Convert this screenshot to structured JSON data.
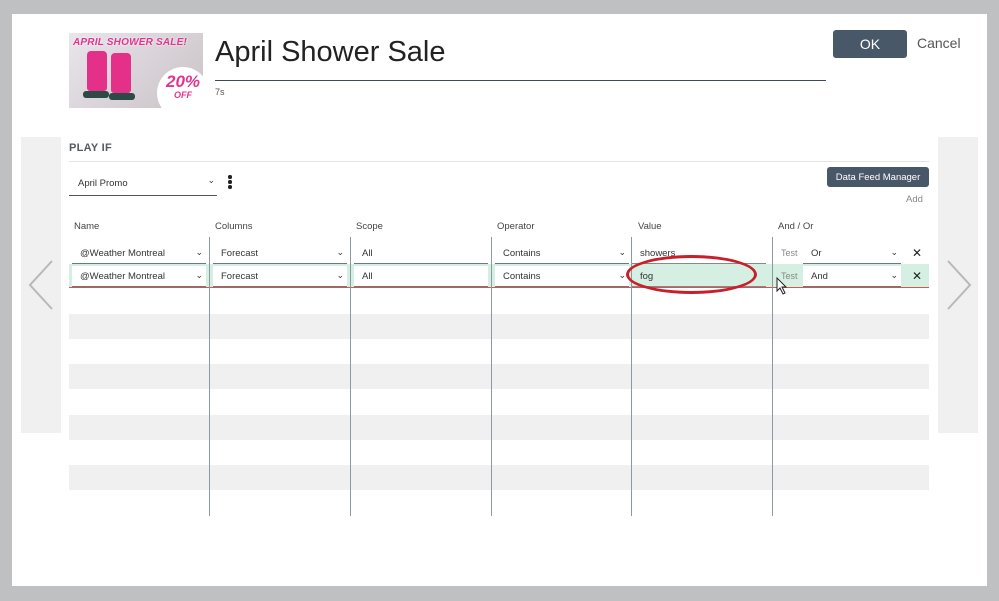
{
  "header": {
    "title": "April Shower Sale",
    "duration": "7s",
    "ok_label": "OK",
    "cancel_label": "Cancel",
    "thumbnail": {
      "sale_text": "APRIL SHOWER SALE!",
      "percent": "20%",
      "off": "OFF"
    }
  },
  "play_if": {
    "heading": "PLAY IF",
    "campaign_selected": "April Promo",
    "data_feed_manager_label": "Data Feed Manager",
    "add_label": "Add"
  },
  "table": {
    "columns": [
      "Name",
      "Columns",
      "Scope",
      "Operator",
      "Value",
      "And / Or"
    ],
    "rows": [
      {
        "name": "@Weather Montreal",
        "column": "Forecast",
        "scope": "All",
        "operator": "Contains",
        "value": "showers",
        "test": "Test",
        "and_or": "Or"
      },
      {
        "name": "@Weather Montreal",
        "column": "Forecast",
        "scope": "All",
        "operator": "Contains",
        "value": "fog",
        "test": "Test",
        "and_or": "And"
      }
    ]
  },
  "colors": {
    "primary_button": "#495869",
    "selected_row": "#d5f0e3",
    "highlight": "#c8202a",
    "stripe": "#f0f0f0"
  }
}
